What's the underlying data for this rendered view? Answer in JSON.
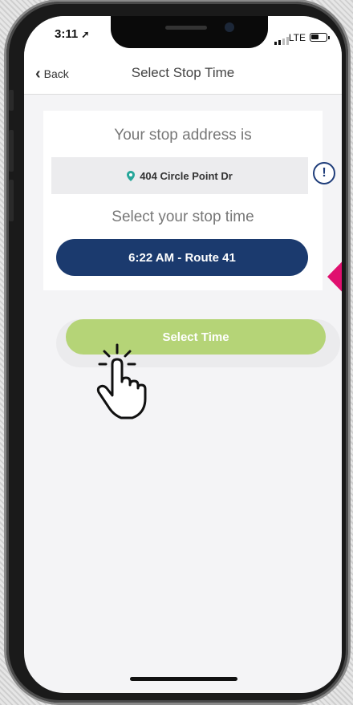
{
  "status_bar": {
    "time": "3:11",
    "network": "LTE"
  },
  "nav": {
    "back_label": "Back",
    "title": "Select Stop Time"
  },
  "card": {
    "address_heading": "Your stop address is",
    "address": "404 Circle Point Dr",
    "time_heading": "Select your stop time",
    "selected_time": "6:22 AM - Route 41"
  },
  "actions": {
    "select_time_label": "Select Time"
  },
  "colors": {
    "primary": "#1b3a6e",
    "accent_green": "#b5d477",
    "pin": "#26a69a",
    "arrow": "#e0106f"
  },
  "icons": [
    "back-chevron-icon",
    "location-pin-icon",
    "info-icon",
    "arrow-left-icon",
    "pointing-hand-icon",
    "battery-icon",
    "signal-icon",
    "location-arrow-icon"
  ]
}
